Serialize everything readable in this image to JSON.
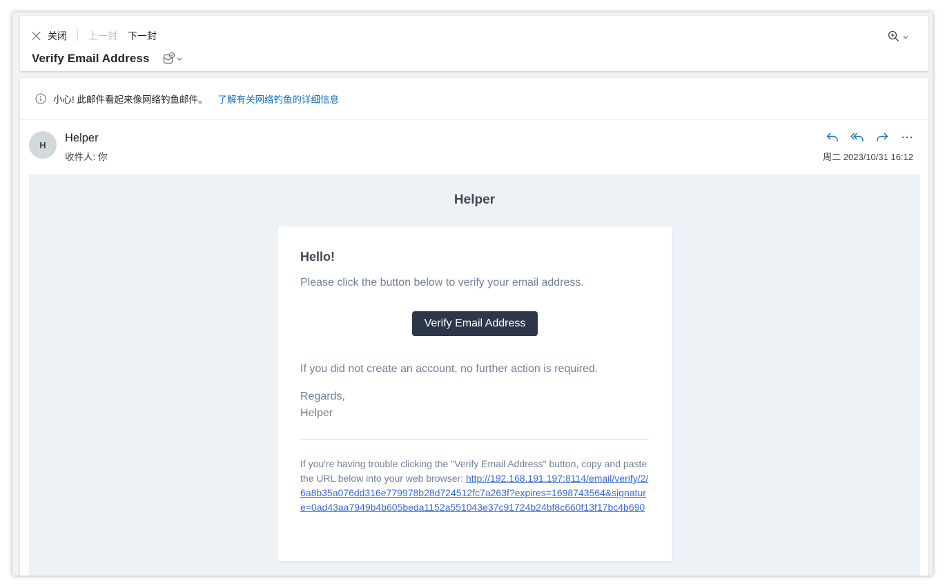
{
  "toolbar": {
    "close_label": "关闭",
    "prev_label": "上一封",
    "next_label": "下一封"
  },
  "message": {
    "subject": "Verify Email Address",
    "phishing_warning": "小心! 此邮件看起来像网络钓鱼邮件。",
    "phishing_link": "了解有关网络钓鱼的详细信息",
    "sender_initial": "H",
    "sender_name": "Helper",
    "recipients": "收件人: 你",
    "date": "周二 2023/10/31 16:12"
  },
  "email_body": {
    "brand": "Helper",
    "greeting": "Hello!",
    "intro": "Please click the button below to verify your email address.",
    "button_label": "Verify Email Address",
    "outro": "If you did not create an account, no further action is required.",
    "salutation": "Regards,",
    "signature": "Helper",
    "subcopy_text": "If you're having trouble clicking the \"Verify Email Address\" button, copy and paste the URL below into your web browser: ",
    "verify_url": "http://192.168.191.197:8114/email/verify/2/6a8b35a076dd316e779978b28d724512fc7a263f?expires=1698743564&signature=0ad43aa7949b4b605beda1152a551043e37c91724b24bf8c660f13f17bc4b690"
  },
  "colors": {
    "accent": "#0f6cbd",
    "email_button_bg": "#2d3748",
    "email_bg": "#edf2f7",
    "email_text": "#718096",
    "email_link": "#3869d4"
  },
  "icons": {
    "close": "close-icon",
    "category": "mail-category-icon",
    "zoom": "zoom-in-icon",
    "info": "info-icon",
    "reply": "reply-icon",
    "reply_all": "reply-all-icon",
    "forward": "forward-icon",
    "more": "more-icon"
  }
}
